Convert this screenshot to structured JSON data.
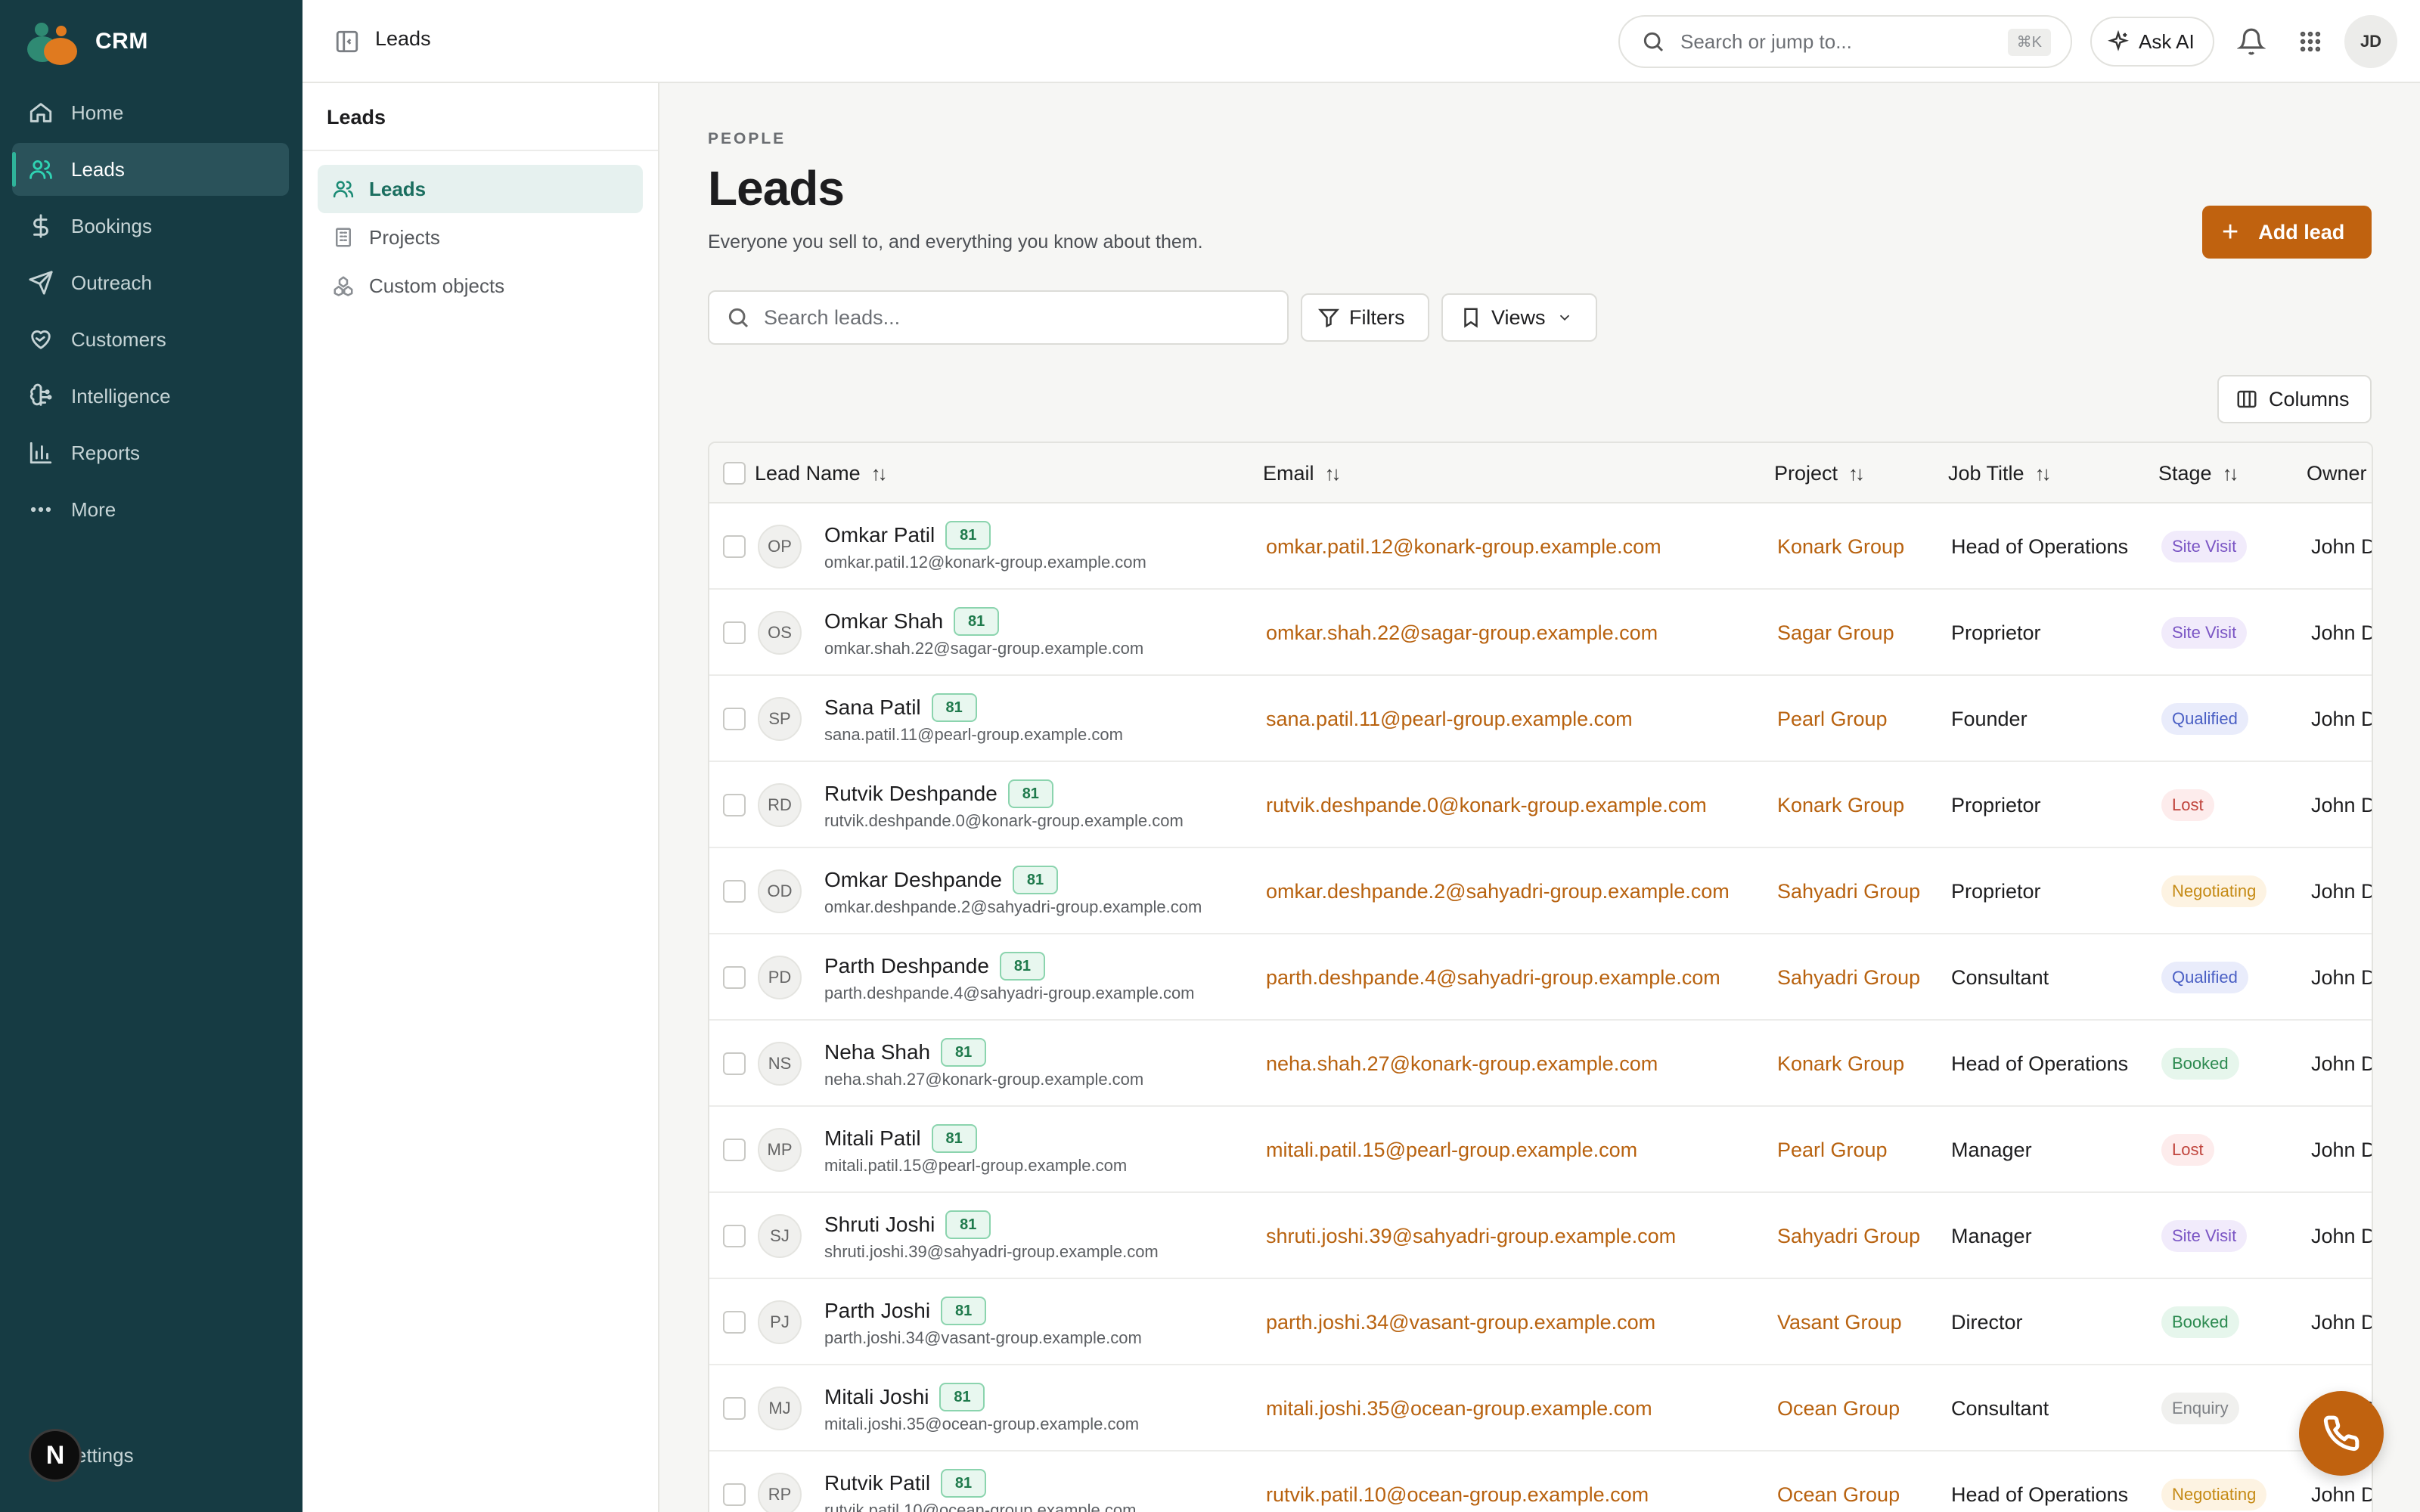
{
  "app": {
    "name": "CRM"
  },
  "sidebar": {
    "items": [
      {
        "label": "Home",
        "icon": "home-icon",
        "active": false
      },
      {
        "label": "Leads",
        "icon": "users-icon",
        "active": true
      },
      {
        "label": "Bookings",
        "icon": "dollar-icon",
        "active": false
      },
      {
        "label": "Outreach",
        "icon": "send-icon",
        "active": false
      },
      {
        "label": "Customers",
        "icon": "heart-handshake-icon",
        "active": false
      },
      {
        "label": "Intelligence",
        "icon": "brain-icon",
        "active": false
      },
      {
        "label": "Reports",
        "icon": "bar-chart-icon",
        "active": false
      },
      {
        "label": "More",
        "icon": "ellipsis-icon",
        "active": false
      }
    ],
    "settings_label": "ettings",
    "settings_badge": "N"
  },
  "subnav": {
    "title": "Leads",
    "items": [
      {
        "label": "Leads",
        "icon": "users-icon",
        "active": true
      },
      {
        "label": "Projects",
        "icon": "building-icon",
        "active": false
      },
      {
        "label": "Custom objects",
        "icon": "shapes-icon",
        "active": false
      }
    ]
  },
  "topbar": {
    "breadcrumb": "Leads",
    "search_placeholder": "Search or jump to...",
    "search_shortcut": "⌘K",
    "ask_ai": "Ask AI",
    "avatar_initials": "JD"
  },
  "page": {
    "eyebrow": "PEOPLE",
    "title": "Leads",
    "subtitle": "Everyone you sell to, and everything you know about them.",
    "add_button": "Add lead",
    "search_placeholder": "Search leads...",
    "filters_label": "Filters",
    "views_label": "Views",
    "columns_label": "Columns"
  },
  "table": {
    "columns": [
      "Lead Name",
      "Email",
      "Project",
      "Job Title",
      "Stage",
      "Owner"
    ],
    "stage_colors": {
      "Site Visit": {
        "bg": "#f1ebfb",
        "fg": "#7a55c4"
      },
      "Qualified": {
        "bg": "#e9ecfb",
        "fg": "#4a5fc4"
      },
      "Lost": {
        "bg": "#fdecec",
        "fg": "#c0443c"
      },
      "Negotiating": {
        "bg": "#fdf3e2",
        "fg": "#c58a14"
      },
      "Booked": {
        "bg": "#e6f6ec",
        "fg": "#2c8a50"
      },
      "Enquiry": {
        "bg": "#f0f0ee",
        "fg": "#7d8085"
      }
    },
    "rows": [
      {
        "initials": "OP",
        "name": "Omkar Patil",
        "score": "81",
        "email": "omkar.patil.12@konark-group.example.com",
        "project": "Konark Group",
        "job_title": "Head of Operations",
        "stage": "Site Visit",
        "owner": "John D"
      },
      {
        "initials": "OS",
        "name": "Omkar Shah",
        "score": "81",
        "email": "omkar.shah.22@sagar-group.example.com",
        "project": "Sagar Group",
        "job_title": "Proprietor",
        "stage": "Site Visit",
        "owner": "John D"
      },
      {
        "initials": "SP",
        "name": "Sana Patil",
        "score": "81",
        "email": "sana.patil.11@pearl-group.example.com",
        "project": "Pearl Group",
        "job_title": "Founder",
        "stage": "Qualified",
        "owner": "John D"
      },
      {
        "initials": "RD",
        "name": "Rutvik Deshpande",
        "score": "81",
        "email": "rutvik.deshpande.0@konark-group.example.com",
        "project": "Konark Group",
        "job_title": "Proprietor",
        "stage": "Lost",
        "owner": "John D"
      },
      {
        "initials": "OD",
        "name": "Omkar Deshpande",
        "score": "81",
        "email": "omkar.deshpande.2@sahyadri-group.example.com",
        "project": "Sahyadri Group",
        "job_title": "Proprietor",
        "stage": "Negotiating",
        "owner": "John D"
      },
      {
        "initials": "PD",
        "name": "Parth Deshpande",
        "score": "81",
        "email": "parth.deshpande.4@sahyadri-group.example.com",
        "project": "Sahyadri Group",
        "job_title": "Consultant",
        "stage": "Qualified",
        "owner": "John D"
      },
      {
        "initials": "NS",
        "name": "Neha Shah",
        "score": "81",
        "email": "neha.shah.27@konark-group.example.com",
        "project": "Konark Group",
        "job_title": "Head of Operations",
        "stage": "Booked",
        "owner": "John D"
      },
      {
        "initials": "MP",
        "name": "Mitali Patil",
        "score": "81",
        "email": "mitali.patil.15@pearl-group.example.com",
        "project": "Pearl Group",
        "job_title": "Manager",
        "stage": "Lost",
        "owner": "John D"
      },
      {
        "initials": "SJ",
        "name": "Shruti Joshi",
        "score": "81",
        "email": "shruti.joshi.39@sahyadri-group.example.com",
        "project": "Sahyadri Group",
        "job_title": "Manager",
        "stage": "Site Visit",
        "owner": "John D"
      },
      {
        "initials": "PJ",
        "name": "Parth Joshi",
        "score": "81",
        "email": "parth.joshi.34@vasant-group.example.com",
        "project": "Vasant Group",
        "job_title": "Director",
        "stage": "Booked",
        "owner": "John D"
      },
      {
        "initials": "MJ",
        "name": "Mitali Joshi",
        "score": "81",
        "email": "mitali.joshi.35@ocean-group.example.com",
        "project": "Ocean Group",
        "job_title": "Consultant",
        "stage": "Enquiry",
        "owner": "John D"
      },
      {
        "initials": "RP",
        "name": "Rutvik Patil",
        "score": "81",
        "email": "rutvik.patil.10@ocean-group.example.com",
        "project": "Ocean Group",
        "job_title": "Head of Operations",
        "stage": "Negotiating",
        "owner": "John D"
      }
    ]
  }
}
